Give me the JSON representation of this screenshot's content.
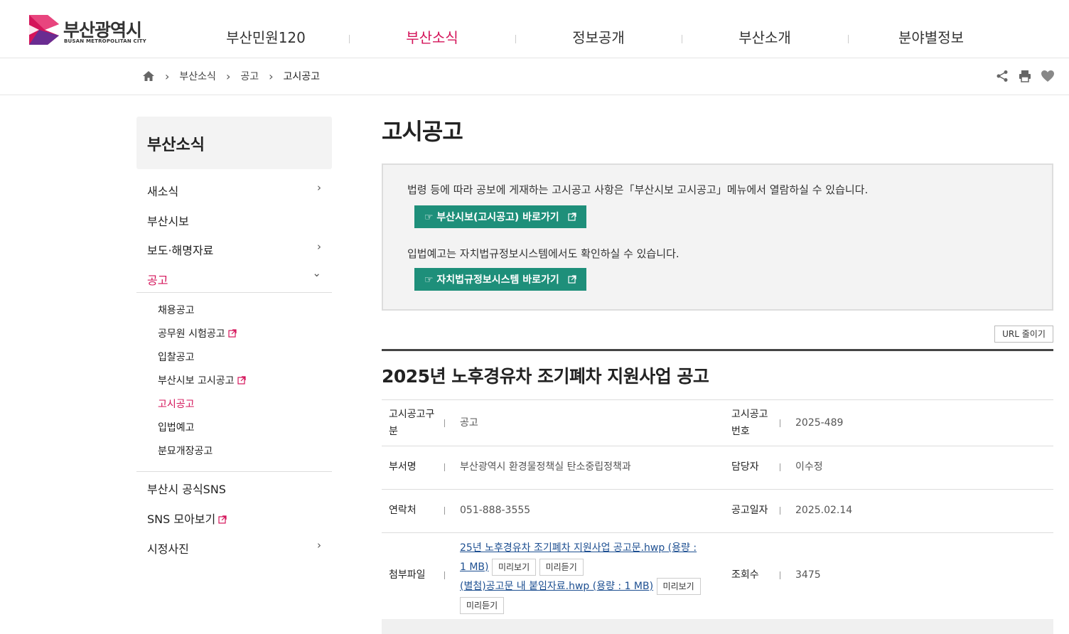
{
  "header": {
    "logo_ko": "부산광역시",
    "logo_en": "BUSAN METROPOLITAN CITY",
    "gnb": [
      "부산민원120",
      "부산소식",
      "정보공개",
      "부산소개",
      "분야별정보"
    ]
  },
  "breadcrumb": [
    "부산소식",
    "공고",
    "고시공고"
  ],
  "sidebar": {
    "title": "부산소식",
    "items": [
      {
        "label": "새소식",
        "arrow": "›"
      },
      {
        "label": "부산시보",
        "arrow": ""
      },
      {
        "label": "보도·해명자료",
        "arrow": "›"
      },
      {
        "label": "공고",
        "arrow": "⌄"
      }
    ],
    "sub_items": [
      "채용공고",
      "공무원 시험공고",
      "입찰공고",
      "부산시보 고시공고",
      "고시공고",
      "입법예고",
      "분묘개장공고"
    ],
    "bottom_items": [
      {
        "label": "부산시 공식SNS",
        "arrow": ""
      },
      {
        "label": "SNS 모아보기",
        "arrow": ""
      },
      {
        "label": "시정사진",
        "arrow": "›"
      }
    ]
  },
  "main": {
    "page_title": "고시공고",
    "notice": {
      "text1": "법령 등에 따라 공보에 게재하는 고시공고 사항은「부산시보 고시공고」메뉴에서 열람하실 수 있습니다.",
      "btn1": "☞ 부산시보(고시공고) 바로가기",
      "text2": "입법예고는 자치법규정보시스템에서도 확인하실 수 있습니다.",
      "btn2": "☞ 자치법규정보시스템 바로가기"
    },
    "url_button": "URL 줄이기",
    "doc_title": "2025년 노후경유차 조기폐차 지원사업 공고",
    "table": {
      "r1": {
        "k1a": "고시공고구",
        "k1b": "분",
        "v1": "공고",
        "k2a": "고시공고",
        "k2b": "번호",
        "v2": "2025-489"
      },
      "r2": {
        "k1": "부서명",
        "v1": "부산광역시 환경물정책실 탄소중립정책과",
        "k2": "담당자",
        "v2": "이수정"
      },
      "r3": {
        "k1": "연락처",
        "v1": "051-888-3555",
        "k2": "공고일자",
        "v2": "2025.02.14"
      },
      "r4": {
        "k1": "첨부파일",
        "file1a": "25년 노후경유차 조기폐차 지원사업 공고문.hwp (용량 :",
        "file1b": "1 MB)",
        "file2": "(별첨)공고문 내 붙임자료.hwp (용량 : 1 MB)",
        "preview": "미리보기",
        "listen": "미리듣기",
        "k2": "조회수",
        "v2": "3475"
      }
    }
  },
  "colors": {
    "accent": "#d4145a",
    "button": "#1e8f7a",
    "link": "#1d4f91"
  }
}
